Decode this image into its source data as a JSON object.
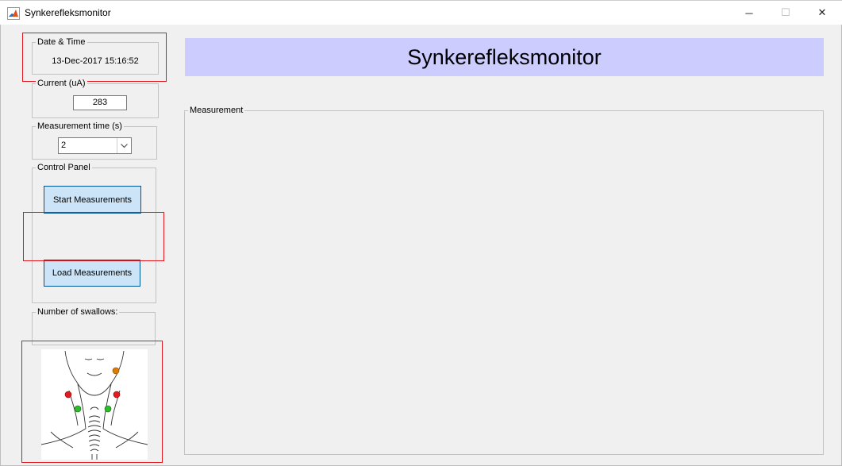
{
  "window": {
    "title": "Synkerefleksmonitor",
    "icon": "matlab-icon",
    "controls": {
      "minimize": "─",
      "maximize": "☐",
      "close": "✕"
    }
  },
  "datetime": {
    "label": "Date & Time",
    "value": "13-Dec-2017 15:16:52"
  },
  "current": {
    "label": "Current (uA)",
    "value": "283"
  },
  "measurement_time": {
    "label": "Measurement time (s)",
    "selected": "2"
  },
  "control_panel": {
    "label": "Control Panel",
    "start_label": "Start Measurements",
    "load_label": "Load Measurements"
  },
  "swallows": {
    "label": "Number of swallows:"
  },
  "banner": {
    "title": "Synkerefleksmonitor",
    "color": "#ccccff"
  },
  "measurement_panel": {
    "label": "Measurement"
  },
  "electrodes": {
    "colors": {
      "orange": "#e07b00",
      "red": "#e41a1c",
      "green": "#2bbd2b"
    }
  },
  "highlight_color": "#e0161e"
}
